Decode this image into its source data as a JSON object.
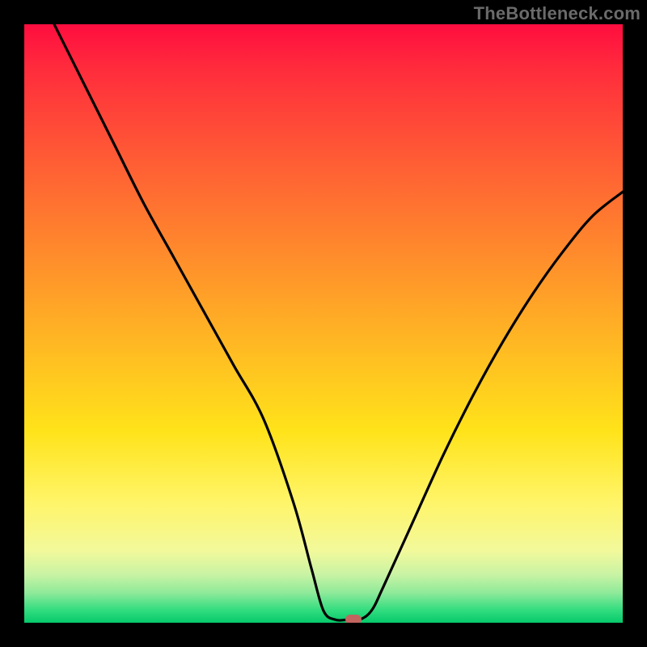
{
  "watermark": "TheBottleneck.com",
  "colors": {
    "frame": "#000000",
    "watermark": "#6a6a6a",
    "curve": "#000000",
    "marker": "#c3655f",
    "gradient_stops": [
      "#ff0d3f",
      "#ff2e3c",
      "#ff5a35",
      "#ff8a2c",
      "#ffba23",
      "#ffe31a",
      "#fff56a",
      "#f2f99b",
      "#c8f3a4",
      "#8eea9a",
      "#2fdc7e",
      "#06c96b"
    ]
  },
  "chart_data": {
    "type": "line",
    "title": "",
    "xlabel": "",
    "ylabel": "",
    "xlim": [
      0,
      100
    ],
    "ylim": [
      0,
      100
    ],
    "grid": false,
    "legend": false,
    "series": [
      {
        "name": "curve",
        "x": [
          5,
          10,
          15,
          20,
          25,
          30,
          35,
          40,
          45,
          48,
          50,
          52,
          54,
          56,
          58,
          60,
          65,
          70,
          75,
          80,
          85,
          90,
          95,
          100
        ],
        "y": [
          100,
          90,
          80,
          70,
          61,
          52,
          43,
          34,
          20,
          9,
          2,
          0.5,
          0.5,
          0.5,
          2,
          6,
          17,
          28,
          38,
          47,
          55,
          62,
          68,
          72
        ]
      }
    ],
    "marker": {
      "x": 55,
      "y": 0.5
    }
  }
}
